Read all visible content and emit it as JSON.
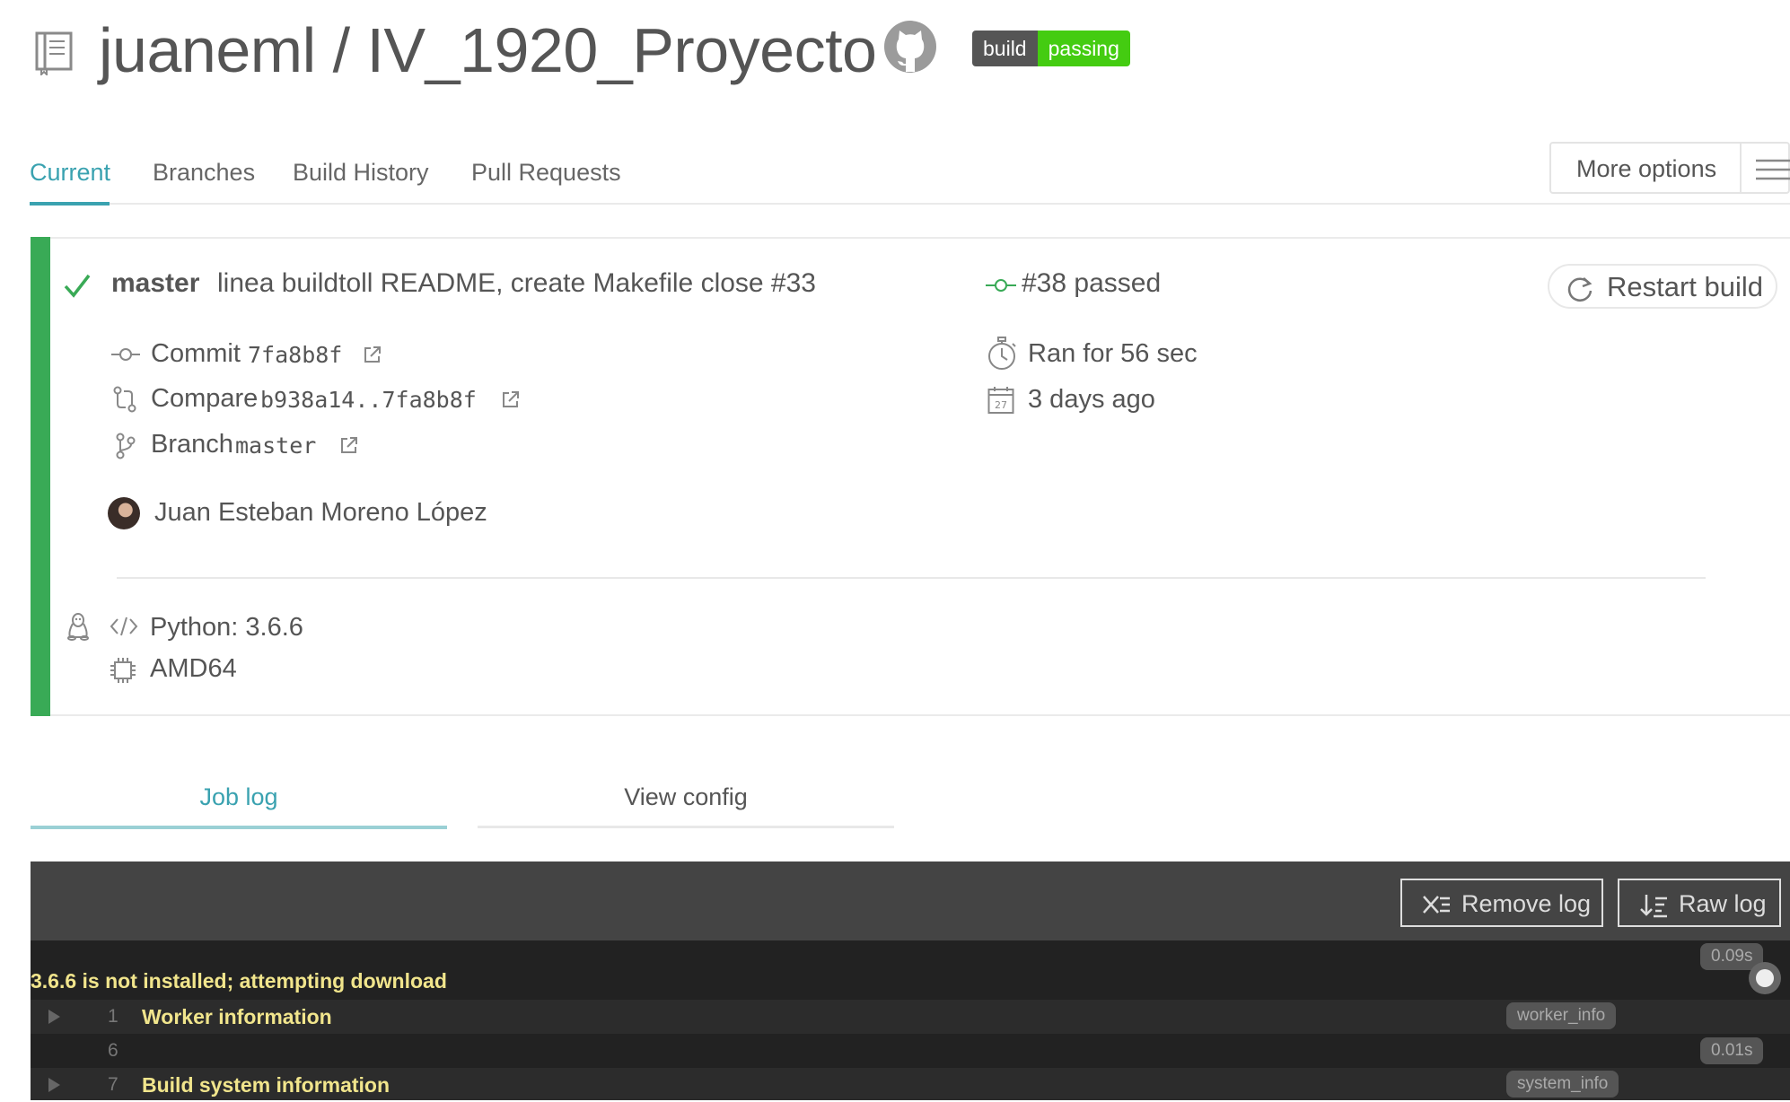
{
  "header": {
    "repo_title": "juaneml / IV_1920_Proyecto",
    "badge_left": "build",
    "badge_right": "passing"
  },
  "tabs": [
    {
      "label": "Current",
      "active": true
    },
    {
      "label": "Branches"
    },
    {
      "label": "Build History"
    },
    {
      "label": "Pull Requests"
    }
  ],
  "more_options_label": "More options",
  "build": {
    "branch": "master",
    "commit_message": "linea buildtoll README, create Makefile close #33",
    "build_status": "#38 passed",
    "restart_label": "Restart build",
    "commit_label": "Commit",
    "commit_hash": "7fa8b8f",
    "compare_label": "Compare",
    "compare_range": "b938a14..7fa8b8f",
    "branch_label": "Branch",
    "branch_value": "master",
    "author": "Juan Esteban Moreno López",
    "duration": "Ran for 56 sec",
    "date": "3 days ago",
    "calendar_day": "27",
    "language": "Python: 3.6.6",
    "arch": "AMD64",
    "status_color": "#39aa56"
  },
  "job_tabs": {
    "job_log": "Job log",
    "view_config": "View config"
  },
  "log": {
    "remove_label": "Remove log",
    "raw_label": "Raw log",
    "lines": [
      {
        "text": "3.6.6 is not installed; attempting download",
        "time": "0.09s"
      },
      {
        "num": "1",
        "text": "Worker information",
        "tag": "worker_info"
      },
      {
        "num": "6",
        "text": "",
        "time": "0.01s"
      },
      {
        "num": "7",
        "text": "Build system information",
        "tag": "system_info"
      }
    ]
  }
}
